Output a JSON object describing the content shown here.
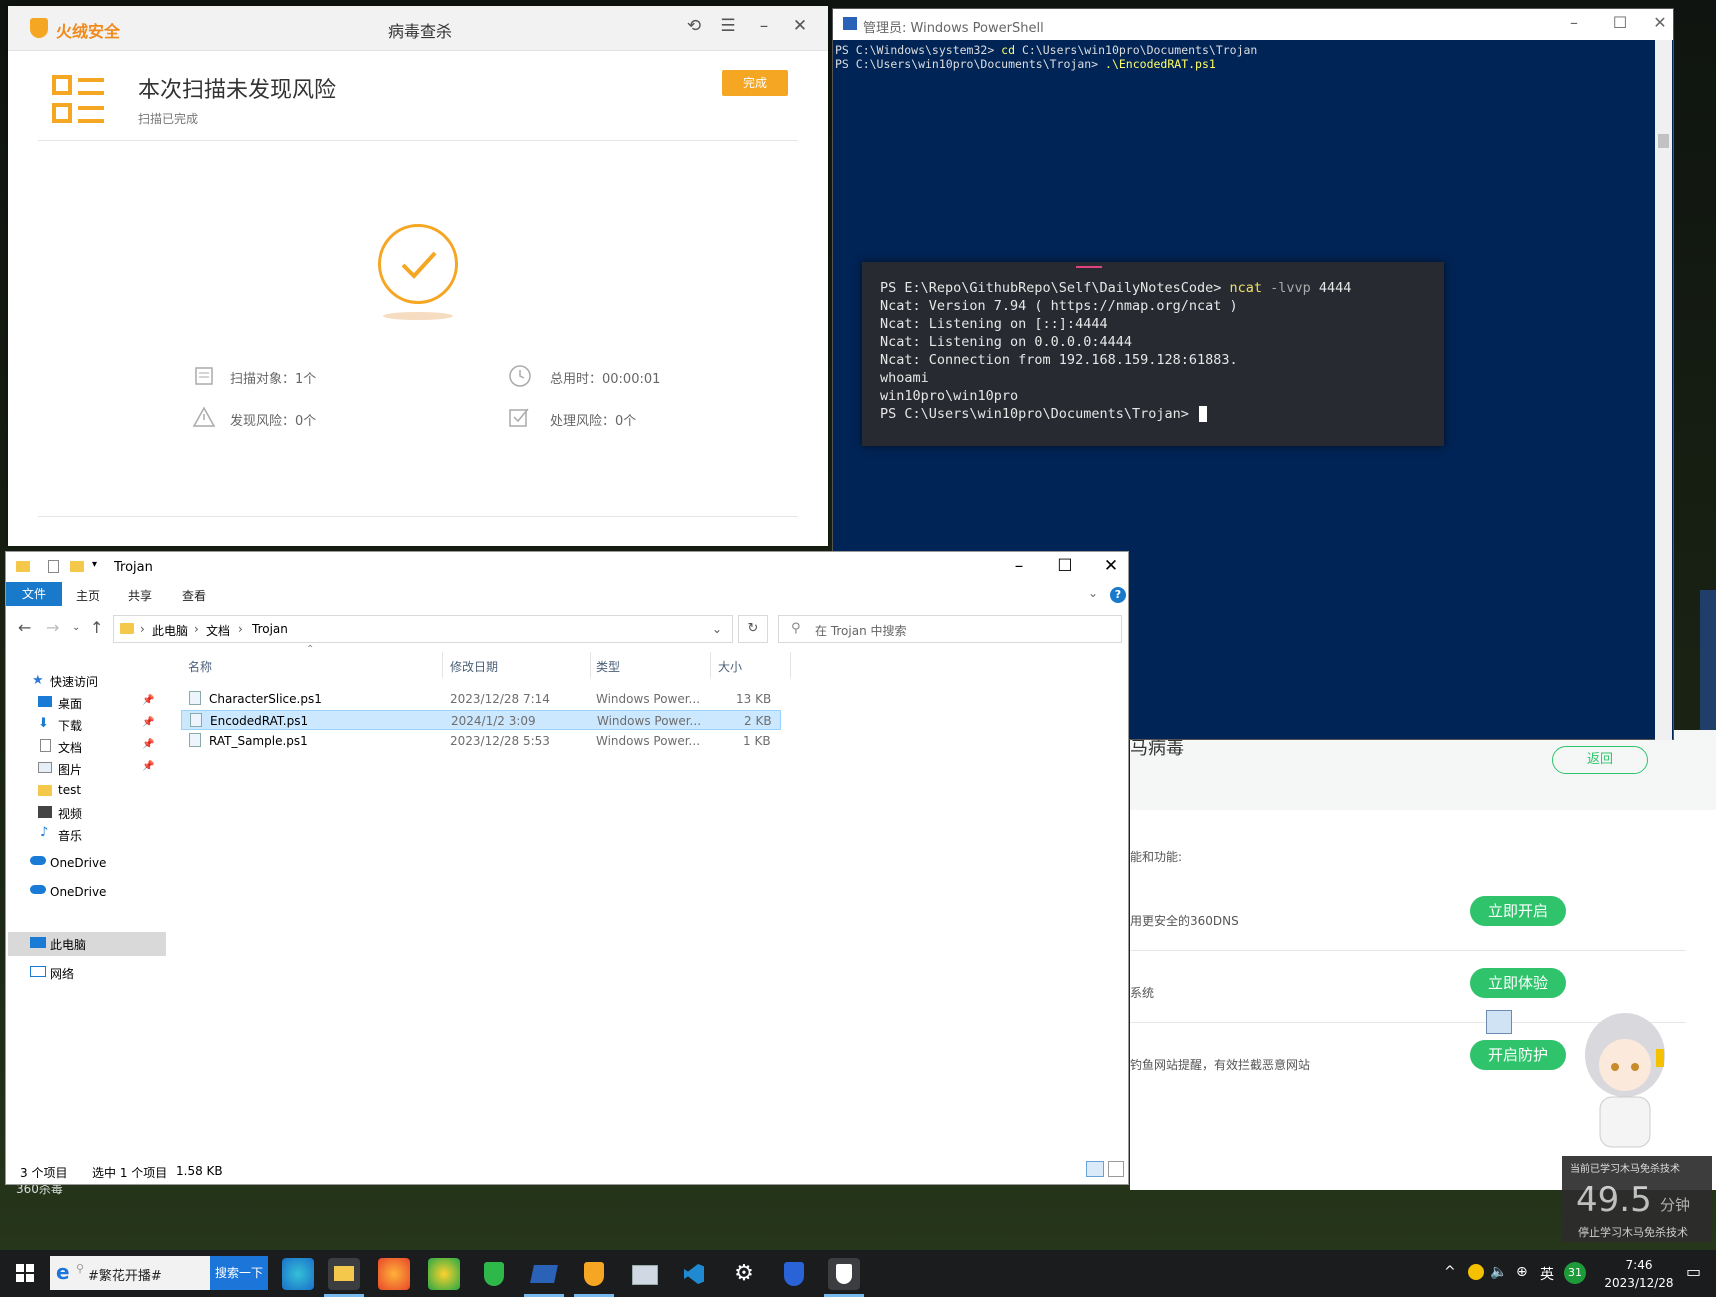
{
  "desktop": {
    "label_360": "360杀毒"
  },
  "bg360": {
    "title": "马病毒",
    "back_label": "返回",
    "header_text": "能和功能:",
    "items": [
      {
        "text": "用更安全的360DNS",
        "button": "立即开启"
      },
      {
        "text": "系统",
        "button": "立即体验"
      },
      {
        "text": "钓鱼网站提醒，有效拦截恶意网站",
        "button": "开启防护"
      }
    ],
    "accent": "#2fc46b"
  },
  "huorong": {
    "brand": "火绒安全",
    "window_title": "病毒查杀",
    "heading": "本次扫描未发现风险",
    "sub": "扫描已完成",
    "done_label": "完成",
    "accent": "#f5a623",
    "stats": [
      {
        "icon": "document-icon",
        "label": "扫描对象：1个"
      },
      {
        "icon": "clock-icon",
        "label": "总用时：00:00:01"
      },
      {
        "icon": "warning-icon",
        "label": "发现风险：0个"
      },
      {
        "icon": "checkbox-icon",
        "label": "处理风险：0个"
      }
    ]
  },
  "powershell": {
    "title": "管理员: Windows PowerShell",
    "line1_prompt": "PS C:\\Windows\\system32> ",
    "line1_cmd": "cd",
    "line1_arg": " C:\\Users\\win10pro\\Documents\\Trojan",
    "line2_prompt": "PS C:\\Users\\win10pro\\Documents\\Trojan> ",
    "line2_cmd": ".\\EncodedRAT.ps1",
    "bg": "#012456"
  },
  "terminal": {
    "prompt": "PS E:\\Repo\\GithubRepo\\Self\\DailyNotesCode> ",
    "cmd": "ncat",
    "flag": " -lvvp",
    "arg": " 4444",
    "lines": [
      "Ncat: Version 7.94 ( https://nmap.org/ncat )",
      "Ncat: Listening on [::]:4444",
      "Ncat: Listening on 0.0.0.0:4444",
      "Ncat: Connection from 192.168.159.128:61883.",
      "whoami",
      "win10pro\\win10pro",
      "PS C:\\Users\\win10pro\\Documents\\Trojan> "
    ]
  },
  "explorer": {
    "title": "Trojan",
    "ribbon": {
      "file": "文件",
      "home": "主页",
      "share": "共享",
      "view": "查看"
    },
    "breadcrumb": [
      "此电脑",
      "文档",
      "Trojan"
    ],
    "search_placeholder": "在 Trojan 中搜索",
    "sidebar": {
      "quick_access": "快速访问",
      "desktop": "桌面",
      "downloads": "下载",
      "documents": "文档",
      "pictures": "图片",
      "test": "test",
      "videos": "视频",
      "music": "音乐",
      "onedrive1": "OneDrive",
      "onedrive2": "OneDrive",
      "this_pc": "此电脑",
      "network": "网络"
    },
    "columns": {
      "name": "名称",
      "modified": "修改日期",
      "type": "类型",
      "size": "大小"
    },
    "files": [
      {
        "name": "CharacterSlice.ps1",
        "modified": "2023/12/28 7:14",
        "type": "Windows Power...",
        "size": "13 KB"
      },
      {
        "name": "EncodedRAT.ps1",
        "modified": "2024/1/2 3:09",
        "type": "Windows Power...",
        "size": "2 KB"
      },
      {
        "name": "RAT_Sample.ps1",
        "modified": "2023/12/28 5:53",
        "type": "Windows Power...",
        "size": "1 KB"
      }
    ],
    "status": {
      "count": "3 个项目",
      "selected": "选中 1 个项目",
      "size": "1.58 KB"
    }
  },
  "widget": {
    "line1": "当前已学习木马免杀技术",
    "value": "49.5",
    "unit": "分钟",
    "line2": "停止学习木马免杀技术"
  },
  "taskbar": {
    "search_text": "#繁花开播#",
    "search_button": "搜索一下",
    "ime": "英",
    "badge": "31",
    "time": "7:46",
    "date": "2023/12/28"
  }
}
